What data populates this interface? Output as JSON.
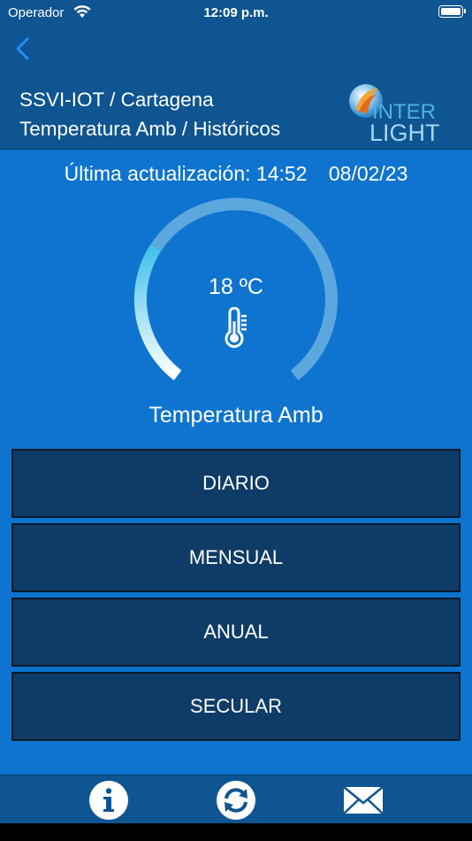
{
  "status_bar": {
    "carrier": "Operador",
    "time": "12:09 p.m."
  },
  "header": {
    "title_line1": "SSVI-IOT / Cartagena",
    "title_line2": "Temperatura Amb / Históricos",
    "logo_text_top": "INTER",
    "logo_text_bottom": "LIGHT"
  },
  "last_update": {
    "label": "Última actualización:",
    "time": "14:52",
    "date": "08/02/23"
  },
  "gauge": {
    "value_text": "18 ºC",
    "sensor_name": "Temperatura Amb"
  },
  "buttons": [
    {
      "label": "DIARIO"
    },
    {
      "label": "MENSUAL"
    },
    {
      "label": "ANUAL"
    },
    {
      "label": "SECULAR"
    }
  ],
  "colors": {
    "header_bg": "#0e5591",
    "content_bg": "#0e74cf",
    "button_bg": "#0f3c66",
    "accent_back": "#1e90ff"
  }
}
